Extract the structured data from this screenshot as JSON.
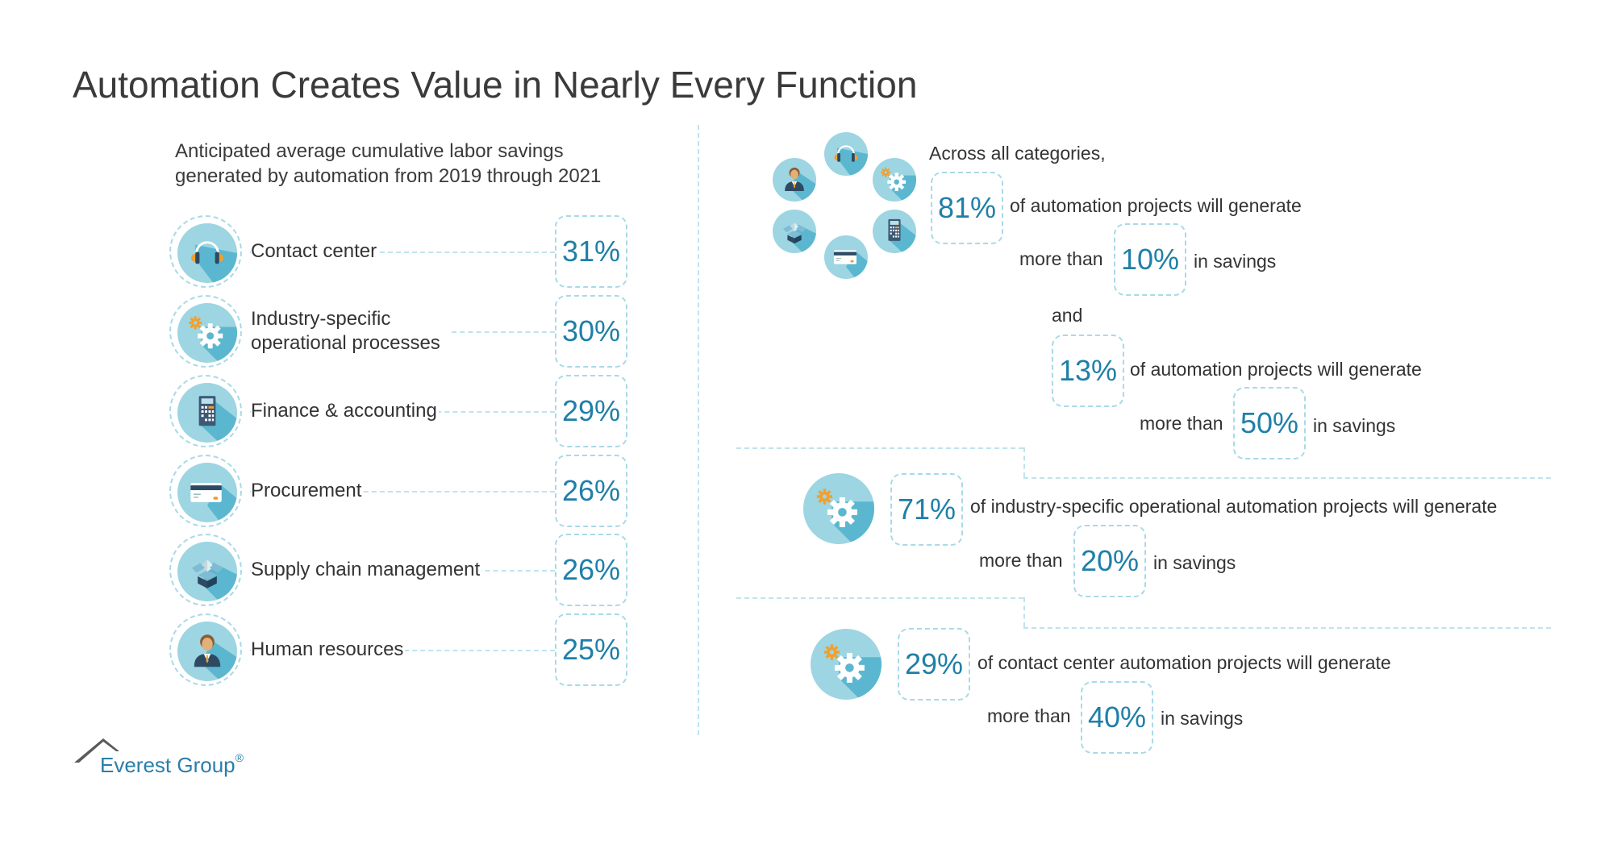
{
  "title": "Automation Creates Value in Nearly Every Function",
  "left_panel": {
    "subtitle_line1": "Anticipated average cumulative labor savings",
    "subtitle_line2": "generated by automation from 2019 through 2021",
    "rows": [
      {
        "label": "Contact center",
        "value": "31%",
        "icon": "headphones-icon"
      },
      {
        "label_line1": "Industry-specific",
        "label_line2": "operational processes",
        "value": "30%",
        "icon": "gears-icon"
      },
      {
        "label": "Finance & accounting",
        "value": "29%",
        "icon": "calculator-icon"
      },
      {
        "label": "Procurement",
        "value": "26%",
        "icon": "credit-card-icon"
      },
      {
        "label": "Supply chain management",
        "value": "26%",
        "icon": "box-icon"
      },
      {
        "label": "Human resources",
        "value": "25%",
        "icon": "person-icon"
      }
    ]
  },
  "right_panel": {
    "section1": {
      "intro": "Across all categories,",
      "stat1_value": "81%",
      "stat1_text": "of automation projects will generate",
      "stat1_more_than": "more than",
      "stat1_threshold": "10%",
      "stat1_suffix": "in savings",
      "connector": "and",
      "stat2_value": "13%",
      "stat2_text": "of automation projects will generate",
      "stat2_more_than": "more than",
      "stat2_threshold": "50%",
      "stat2_suffix": "in savings"
    },
    "section2": {
      "icon": "gears-icon",
      "value": "71%",
      "text": "of industry-specific operational automation projects will generate",
      "more_than": "more than",
      "threshold": "20%",
      "suffix": "in savings"
    },
    "section3": {
      "icon": "gears-icon",
      "value": "29%",
      "text": "of contact center automation projects will generate",
      "more_than": "more than",
      "threshold": "40%",
      "suffix": "in savings"
    }
  },
  "logo": {
    "name": "Everest Group",
    "registered": "®"
  },
  "colors": {
    "accent": "#1f7fa8",
    "circle": "#9dd5e2",
    "circle_shadow": "#5ab7cf",
    "dash": "#a9d9e8",
    "icon_dark": "#2e4a62",
    "icon_orange": "#f0a030"
  }
}
